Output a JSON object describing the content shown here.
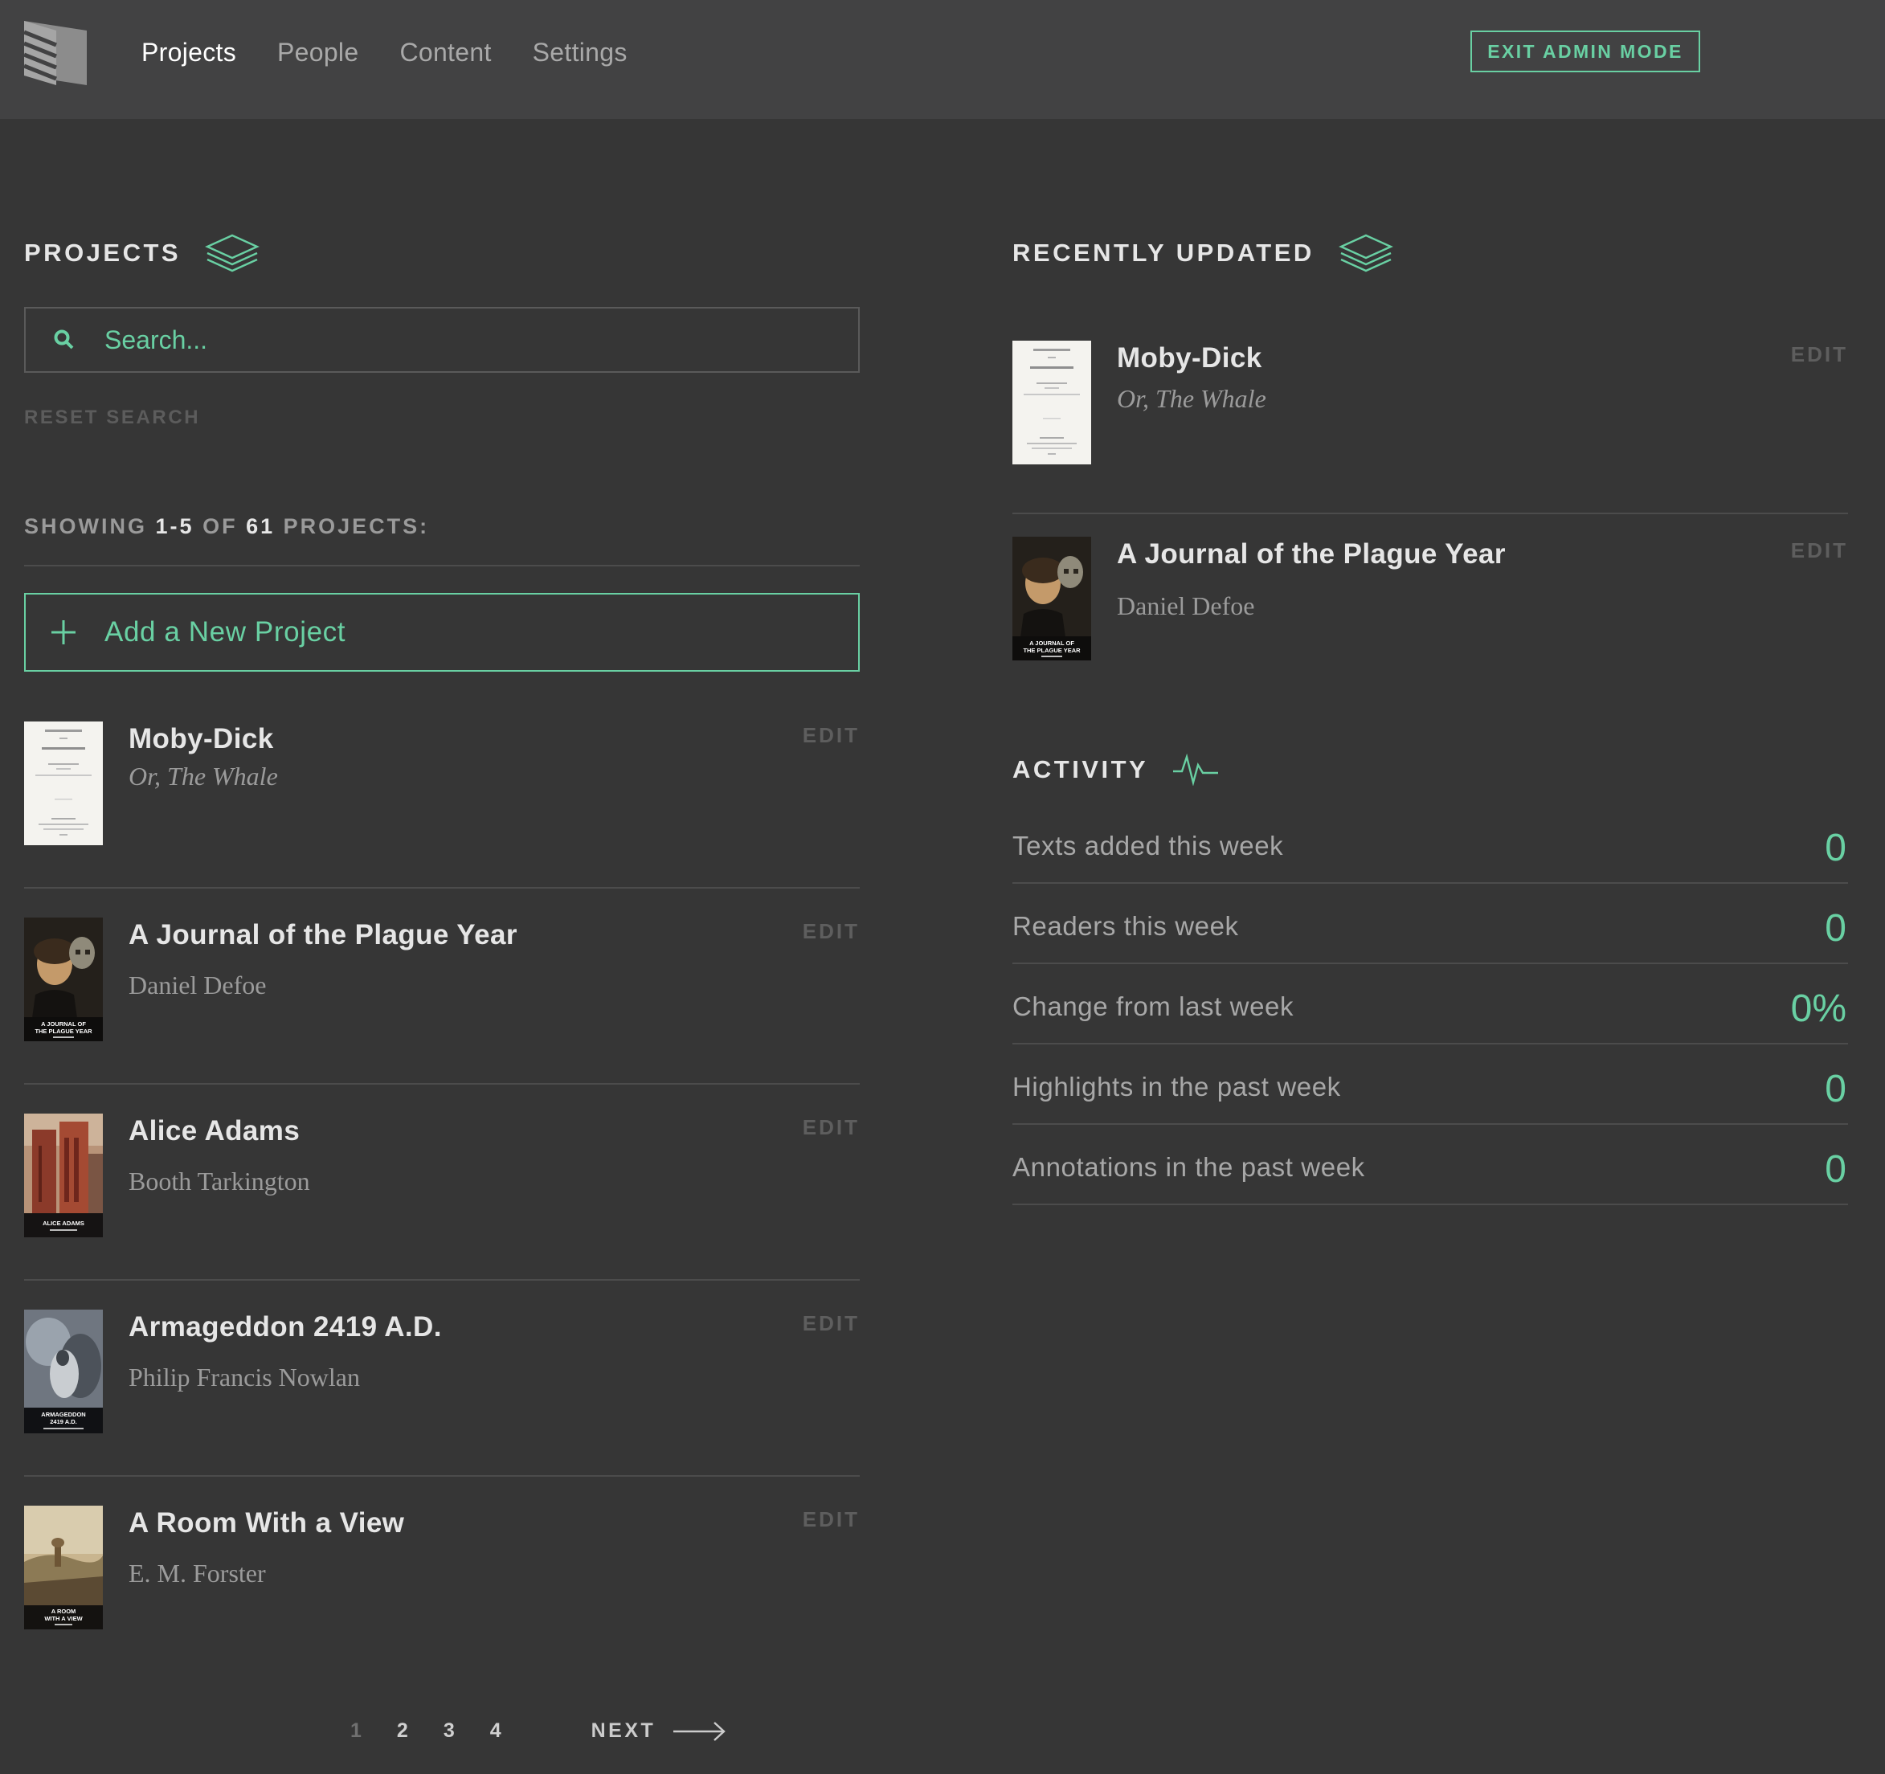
{
  "header": {
    "nav": [
      {
        "label": "Projects",
        "active": true
      },
      {
        "label": "People",
        "active": false
      },
      {
        "label": "Content",
        "active": false
      },
      {
        "label": "Settings",
        "active": false
      }
    ],
    "exit_label": "EXIT ADMIN MODE"
  },
  "colors": {
    "accent": "#69d0a3",
    "background": "#363636",
    "header": "#424243"
  },
  "projects_section": {
    "heading": "PROJECTS",
    "heading_icon": "layers-icon",
    "search_placeholder": "Search...",
    "reset_label": "RESET SEARCH",
    "showing": {
      "prefix": "SHOWING",
      "range": "1-5",
      "of": "OF",
      "total": "61",
      "suffix": "PROJECTS:"
    },
    "add_label": "Add a New Project",
    "items": [
      {
        "title": "Moby-Dick",
        "subtitle": "Or, The Whale",
        "edit": "EDIT",
        "cover": "moby-dick-cover"
      },
      {
        "title": "A Journal of the Plague Year",
        "subtitle": "Daniel Defoe",
        "edit": "EDIT",
        "cover": "plague-year-cover"
      },
      {
        "title": "Alice Adams",
        "subtitle": "Booth Tarkington",
        "edit": "EDIT",
        "cover": "alice-adams-cover"
      },
      {
        "title": "Armageddon 2419 A.D.",
        "subtitle": "Philip Francis Nowlan",
        "edit": "EDIT",
        "cover": "armageddon-cover"
      },
      {
        "title": "A Room With a View",
        "subtitle": "E. M. Forster",
        "edit": "EDIT",
        "cover": "room-with-a-view-cover"
      }
    ],
    "pagination": {
      "pages": [
        "1",
        "2",
        "3",
        "4"
      ],
      "current": "1",
      "next_label": "NEXT"
    }
  },
  "recent_section": {
    "heading": "RECENTLY UPDATED",
    "heading_icon": "layers-icon",
    "items": [
      {
        "title": "Moby-Dick",
        "subtitle": "Or, The Whale",
        "edit": "EDIT",
        "cover": "moby-dick-cover"
      },
      {
        "title": "A Journal of the Plague Year",
        "subtitle": "Daniel Defoe",
        "edit": "EDIT",
        "cover": "plague-year-cover"
      }
    ]
  },
  "activity_section": {
    "heading": "ACTIVITY",
    "heading_icon": "pulse-icon",
    "stats": [
      {
        "label": "Texts added this week",
        "value": "0"
      },
      {
        "label": "Readers this week",
        "value": "0"
      },
      {
        "label": "Change from last week",
        "value": "0%"
      },
      {
        "label": "Highlights in the past week",
        "value": "0"
      },
      {
        "label": "Annotations in the past week",
        "value": "0"
      }
    ]
  },
  "covers": {
    "plague_year_text": [
      "A JOURNAL OF",
      "THE PLAGUE YEAR"
    ],
    "alice_adams_text": [
      "ALICE ADAMS"
    ],
    "armageddon_text": [
      "ARMAGEDDON",
      "2419 A.D."
    ],
    "room_view_text": [
      "A ROOM",
      "WITH A VIEW"
    ]
  }
}
